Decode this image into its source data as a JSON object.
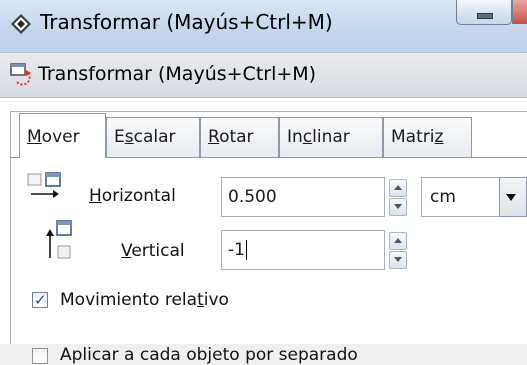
{
  "window": {
    "title": "Transformar (Mayús+Ctrl+M)"
  },
  "docker": {
    "title": "Transformar (Mayús+Ctrl+M)"
  },
  "tabs": [
    {
      "label": "Mover",
      "mnemonic": "M",
      "rest": "over",
      "active": true
    },
    {
      "label": "Escalar",
      "pre": "E",
      "mnemonic": "s",
      "rest": "calar",
      "active": false
    },
    {
      "label": "Rotar",
      "mnemonic": "R",
      "rest": "otar",
      "active": false
    },
    {
      "label": "Inclinar",
      "pre": "In",
      "mnemonic": "c",
      "rest": "linar",
      "active": false
    },
    {
      "label": "Matriz",
      "pre": "Matri",
      "mnemonic": "z",
      "rest": "",
      "active": false
    }
  ],
  "move": {
    "horizontal": {
      "label_mnemonic": "H",
      "label_rest": "orizontal",
      "value": "0.500"
    },
    "vertical": {
      "label_mnemonic": "V",
      "label_rest": "ertical",
      "value": "-1"
    },
    "unit": "cm"
  },
  "relative": {
    "label_pre": "Movimiento rela",
    "label_mnemonic": "t",
    "label_rest": "ivo",
    "checked": true
  },
  "separate": {
    "label": "Aplicar a cada objeto por separado",
    "checked": false
  },
  "colors": {
    "titlebar": "#c4d6ec",
    "accent": "#2b4f86",
    "docker_icon_red": "#d9302a"
  }
}
